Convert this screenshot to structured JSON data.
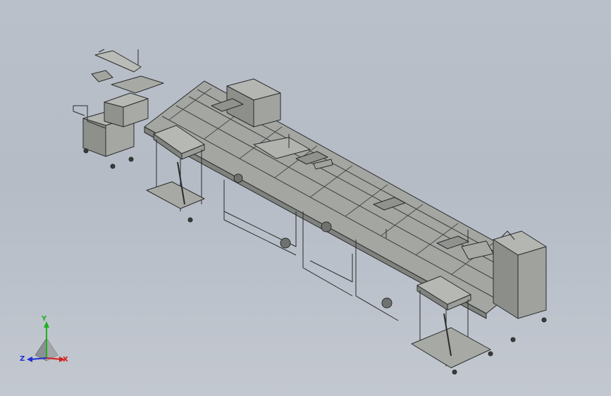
{
  "viewport": {
    "background_top": "#b9c0c9",
    "background_bottom": "#c3c8d0",
    "model_name": "assembly-line-conveyor"
  },
  "triad": {
    "x_label": "X",
    "y_label": "Y",
    "z_label": "Z",
    "x_color": "#d42020",
    "y_color": "#20b020",
    "z_color": "#2030d0"
  }
}
